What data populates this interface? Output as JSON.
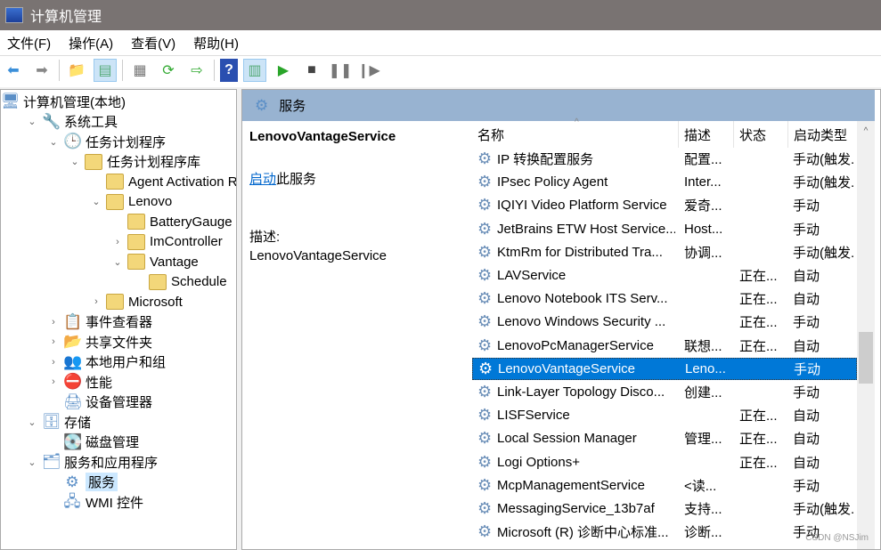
{
  "window": {
    "title": "计算机管理"
  },
  "menu": [
    "文件(F)",
    "操作(A)",
    "查看(V)",
    "帮助(H)"
  ],
  "tree": [
    {
      "label": "计算机管理(本地)",
      "level": 0,
      "chev": "",
      "icon": "computer"
    },
    {
      "label": "系统工具",
      "level": 1,
      "chev": "⌄",
      "icon": "tools"
    },
    {
      "label": "任务计划程序",
      "level": 2,
      "chev": "⌄",
      "icon": "clock"
    },
    {
      "label": "任务计划程序库",
      "level": 3,
      "chev": "⌄",
      "icon": "folder"
    },
    {
      "label": "Agent Activation Rur",
      "level": 4,
      "chev": "",
      "icon": "folder"
    },
    {
      "label": "Lenovo",
      "level": 4,
      "chev": "⌄",
      "icon": "folder"
    },
    {
      "label": "BatteryGauge",
      "level": 5,
      "chev": "",
      "icon": "folder"
    },
    {
      "label": "ImController",
      "level": 5,
      "chev": "›",
      "icon": "folder"
    },
    {
      "label": "Vantage",
      "level": 5,
      "chev": "⌄",
      "icon": "folder"
    },
    {
      "label": "Schedule",
      "level": 6,
      "chev": "",
      "icon": "folder"
    },
    {
      "label": "Microsoft",
      "level": 4,
      "chev": "›",
      "icon": "folder"
    },
    {
      "label": "事件查看器",
      "level": 2,
      "chev": "›",
      "icon": "event"
    },
    {
      "label": "共享文件夹",
      "level": 2,
      "chev": "›",
      "icon": "share"
    },
    {
      "label": "本地用户和组",
      "level": 2,
      "chev": "›",
      "icon": "users"
    },
    {
      "label": "性能",
      "level": 2,
      "chev": "›",
      "icon": "perf"
    },
    {
      "label": "设备管理器",
      "level": 2,
      "chev": "",
      "icon": "device"
    },
    {
      "label": "存储",
      "level": 1,
      "chev": "⌄",
      "icon": "storage"
    },
    {
      "label": "磁盘管理",
      "level": 2,
      "chev": "",
      "icon": "disk"
    },
    {
      "label": "服务和应用程序",
      "level": 1,
      "chev": "⌄",
      "icon": "apps"
    },
    {
      "label": "服务",
      "level": 2,
      "chev": "",
      "icon": "gear",
      "selected": true
    },
    {
      "label": "WMI 控件",
      "level": 2,
      "chev": "",
      "icon": "wmi"
    }
  ],
  "panel": {
    "title": "服务",
    "service_name": "LenovoVantageService",
    "start_link": "启动",
    "start_suffix": "此服务",
    "desc_label": "描述:",
    "desc": "LenovoVantageService"
  },
  "columns": [
    "名称",
    "描述",
    "状态",
    "启动类型"
  ],
  "services": [
    [
      "IP 转换配置服务",
      "配置...",
      "",
      "手动(触发."
    ],
    [
      "IPsec Policy Agent",
      "Inter...",
      "",
      "手动(触发."
    ],
    [
      "IQIYI Video Platform Service",
      "爱奇...",
      "",
      "手动"
    ],
    [
      "JetBrains ETW Host Service...",
      "Host...",
      "",
      "手动"
    ],
    [
      "KtmRm for Distributed Tra...",
      "协调...",
      "",
      "手动(触发."
    ],
    [
      "LAVService",
      "",
      "正在...",
      "自动"
    ],
    [
      "Lenovo Notebook ITS Serv...",
      "",
      "正在...",
      "自动"
    ],
    [
      "Lenovo Windows Security ...",
      "",
      "正在...",
      "手动"
    ],
    [
      "LenovoPcManagerService",
      "联想...",
      "正在...",
      "自动"
    ],
    [
      "LenovoVantageService",
      "Leno...",
      "",
      "手动"
    ],
    [
      "Link-Layer Topology Disco...",
      "创建...",
      "",
      "手动"
    ],
    [
      "LISFService",
      "",
      "正在...",
      "自动"
    ],
    [
      "Local Session Manager",
      "管理...",
      "正在...",
      "自动"
    ],
    [
      "Logi Options+",
      "",
      "正在...",
      "自动"
    ],
    [
      "McpManagementService",
      "<读...",
      "",
      "手动"
    ],
    [
      "MessagingService_13b7af",
      "支持...",
      "",
      "手动(触发."
    ],
    [
      "Microsoft (R) 诊断中心标准...",
      "诊断...",
      "",
      "手动"
    ]
  ],
  "selected_index": 9,
  "watermark": "CSDN @NSJim"
}
